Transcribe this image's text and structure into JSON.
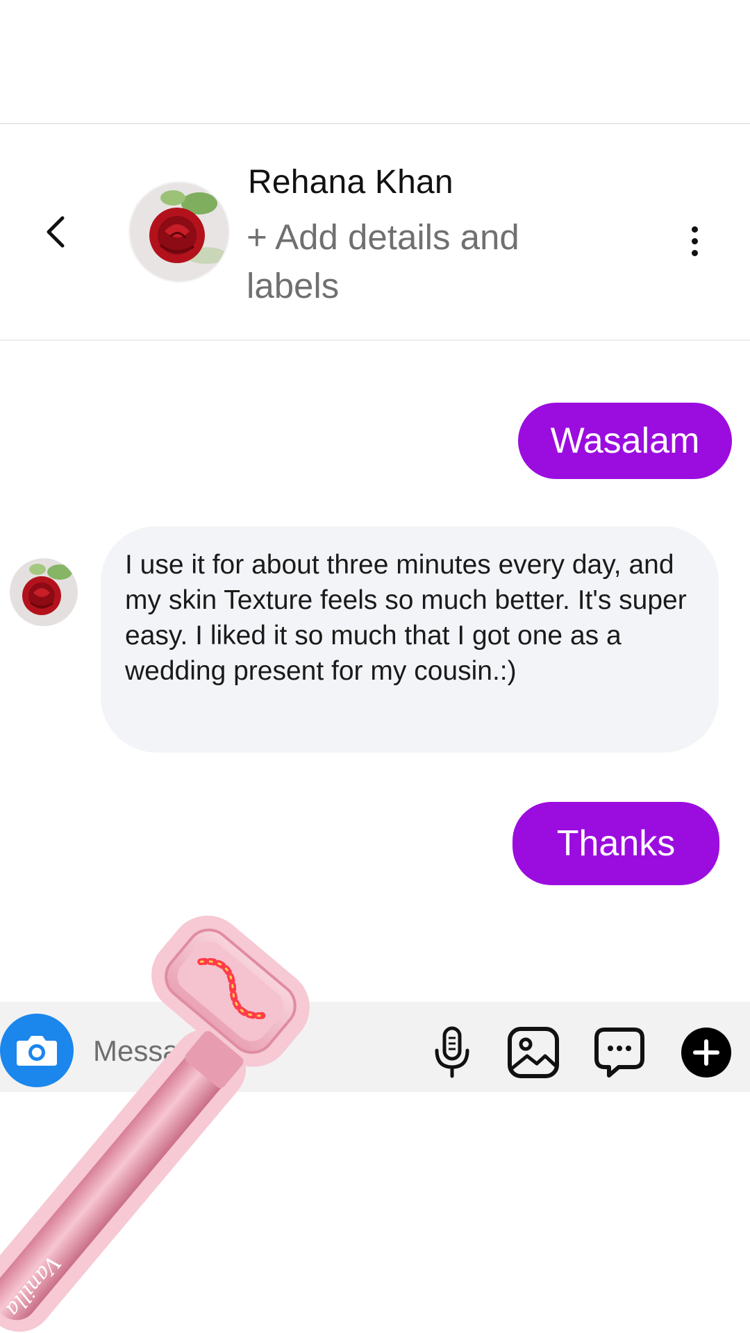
{
  "header": {
    "contact_name": "Rehana Khan",
    "add_details": "+ Add details and labels"
  },
  "messages": [
    {
      "direction": "outgoing",
      "text": "Wasalam"
    },
    {
      "direction": "incoming",
      "text": "I use it for about three minutes every day, and my skin Texture feels so much better. It's super easy. I liked it so much that I got one as a wedding present for my cousin.:)"
    },
    {
      "direction": "outgoing",
      "text": "Thanks"
    }
  ],
  "composer": {
    "placeholder": "Message..."
  },
  "product": {
    "brand": "Vanilla"
  },
  "colors": {
    "outgoing_bubble": "#9b0ddf",
    "incoming_bubble": "#f3f4f7",
    "camera_button": "#1b86ec"
  },
  "icons": {
    "back": "chevron-left-icon",
    "more": "vertical-ellipsis-icon",
    "camera": "camera-icon",
    "mic": "microphone-icon",
    "gallery": "image-icon",
    "sticker": "chat-bubble-dots-icon",
    "plus": "plus-circle-icon"
  }
}
